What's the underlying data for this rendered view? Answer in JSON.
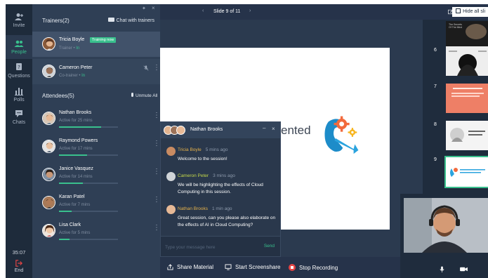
{
  "nav": {
    "invite": "Invite",
    "people": "People",
    "questions": "Questions",
    "polls": "Polls",
    "chats": "Chats",
    "timer": "35:07",
    "end": "End"
  },
  "panel": {
    "trainers_heading": "Trainers(2)",
    "chat_with_trainers": "Chat with trainers",
    "trainers": [
      {
        "name": "Tricia Boyle",
        "role": "Trainer",
        "state": "In",
        "badge": "Training now"
      },
      {
        "name": "Cameron Peter",
        "role": "Co-trainer",
        "state": "In"
      }
    ],
    "attendees_heading": "Attendees(5)",
    "unmute_all": "Unmute All",
    "attendees": [
      {
        "name": "Nathan Brooks",
        "status": "Active for 25 mins",
        "progress": 0.72
      },
      {
        "name": "Raymond Powers",
        "status": "Active for 17 mins",
        "progress": 0.48
      },
      {
        "name": "Janice Vasquez",
        "status": "Active for 14 mins",
        "progress": 0.4
      },
      {
        "name": "Karan Patel",
        "status": "Active for 7 mins",
        "progress": 0.22
      },
      {
        "name": "Lisa Clark",
        "status": "Active for 5 mins",
        "progress": 0.18
      }
    ]
  },
  "topbar": {
    "slide_label": "Slide 9 of 11",
    "hide_all": "Hide all sli"
  },
  "slide": {
    "partial_text": "ented"
  },
  "chat": {
    "title": "Nathan Brooks",
    "messages": [
      {
        "author": "Tricia Boyle",
        "time": "5 mins ago",
        "text": "Welcome to the session!",
        "color": "#e6b24a"
      },
      {
        "author": "Cameron Peter",
        "time": "3 mins ago",
        "text": "We will be highlighting the effects of Cloud Computing in this session.",
        "color": "#c4d84a"
      },
      {
        "author": "Nathan Brooks",
        "time": "1 min ago",
        "text": "Great session, can you please also elaborate on the effects of AI in Cloud Computing?",
        "color": "#e6b24a"
      }
    ],
    "input_placeholder": "Type your message here",
    "send": "Send"
  },
  "bottombar": {
    "share_material": "Share Material",
    "start_screenshare": "Start Screenshare",
    "stop_recording": "Stop Recording"
  },
  "thumbnails": {
    "numbers": [
      "6",
      "7",
      "8",
      "9"
    ],
    "top_partial_text": "The Secrets Of The Mind",
    "selected": "9"
  },
  "colors": {
    "accent": "#39c08d",
    "background": "#2b3a4f",
    "record": "#e64545"
  }
}
